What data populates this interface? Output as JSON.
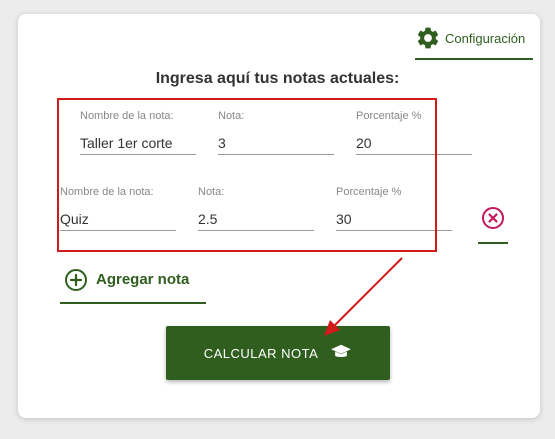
{
  "config": {
    "label": "Configuración",
    "icon": "gear-icon"
  },
  "heading": "Ingresa aquí tus notas actuales:",
  "rows": [
    {
      "name_label": "Nombre de la nota:",
      "name_value": "Taller 1er corte",
      "grade_label": "Nota:",
      "grade_value": "3",
      "percent_label": "Porcentaje %",
      "percent_value": "20"
    },
    {
      "name_label": "Nombre de la nota:",
      "name_value": "Quiz",
      "grade_label": "Nota:",
      "grade_value": "2.5",
      "percent_label": "Porcentaje %",
      "percent_value": "30"
    }
  ],
  "add_button": {
    "label": "Agregar nota",
    "icon": "plus-circle-icon"
  },
  "delete_button": {
    "icon": "close-circle-icon"
  },
  "calc_button": {
    "label": "CALCULAR NOTA",
    "icon": "graduation-cap-icon"
  },
  "colors": {
    "primary_green": "#2f5e1e",
    "highlight_red": "#d11a1a",
    "delete_pink": "#c2185b"
  }
}
